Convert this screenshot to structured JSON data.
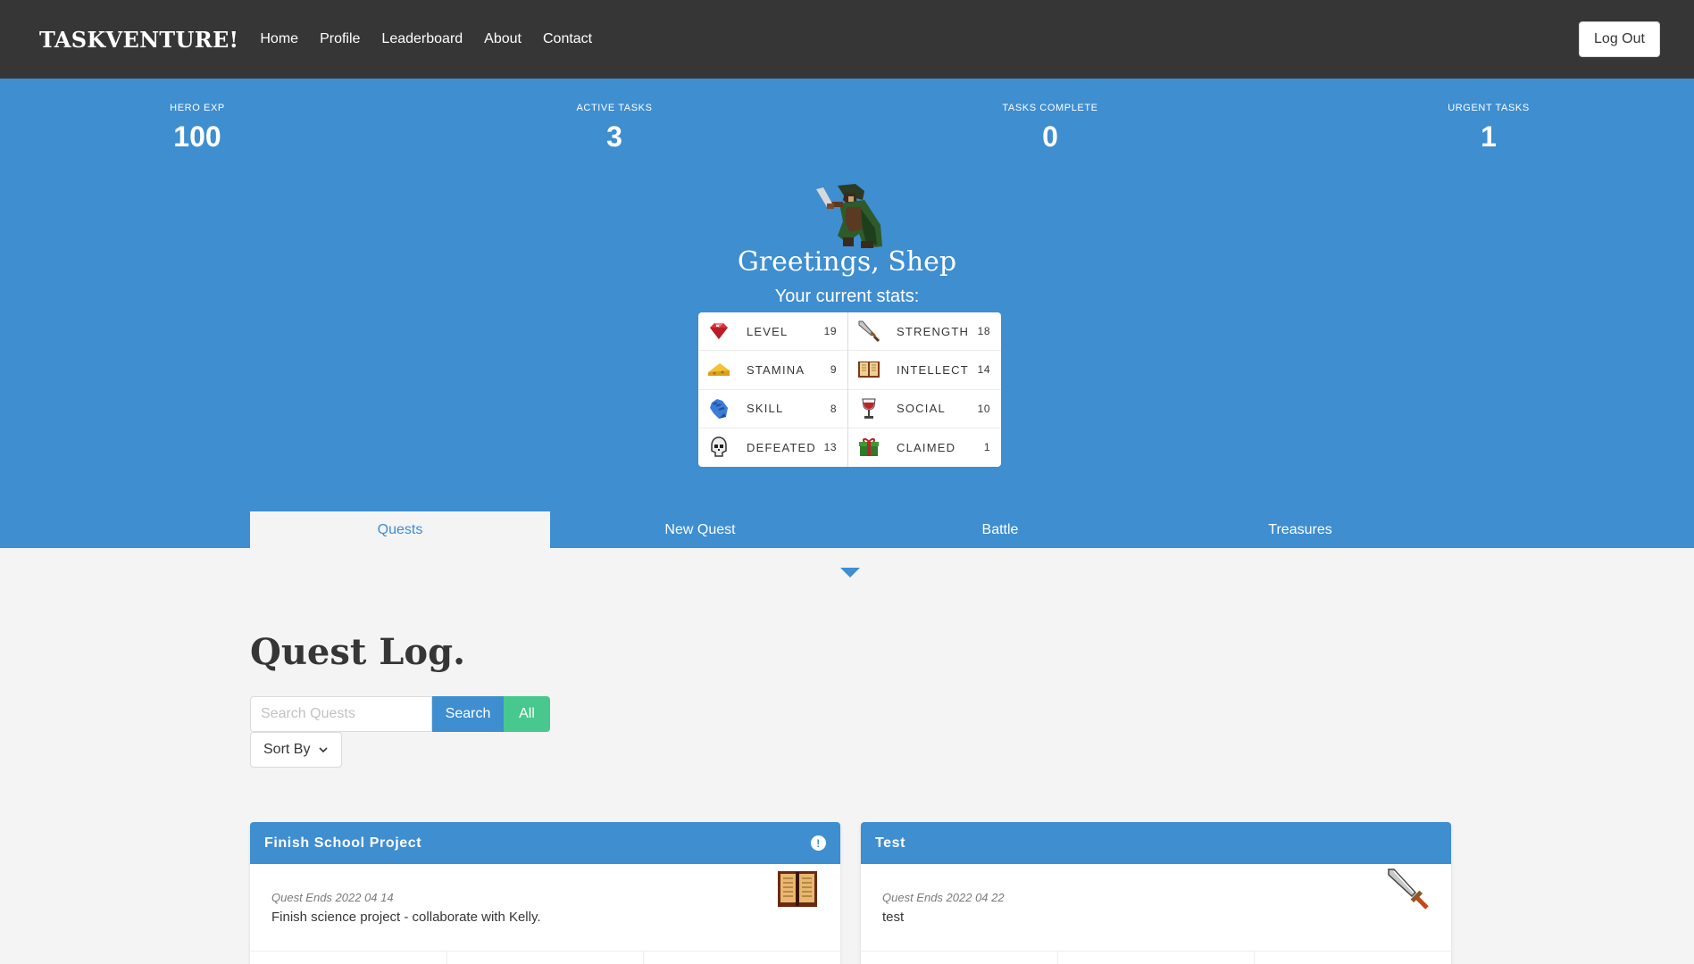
{
  "navbar": {
    "brand": "TASKVENTURE!",
    "links": [
      "Home",
      "Profile",
      "Leaderboard",
      "About",
      "Contact"
    ],
    "logout_label": "Log Out"
  },
  "hero_stats": [
    {
      "heading": "HERO EXP",
      "value": "100"
    },
    {
      "heading": "ACTIVE TASKS",
      "value": "3"
    },
    {
      "heading": "TASKS COMPLETE",
      "value": "0"
    },
    {
      "heading": "URGENT TASKS",
      "value": "1"
    }
  ],
  "greeting": "Greetings, Shep",
  "subgreeting": "Your current stats:",
  "stats_left": [
    {
      "label": "LEVEL",
      "value": "19",
      "icon": "gem-icon"
    },
    {
      "label": "STAMINA",
      "value": "9",
      "icon": "cheese-icon"
    },
    {
      "label": "SKILL",
      "value": "8",
      "icon": "glove-icon"
    },
    {
      "label": "DEFEATED",
      "value": "13",
      "icon": "skull-icon"
    }
  ],
  "stats_right": [
    {
      "label": "STRENGTH",
      "value": "18",
      "icon": "sword-icon"
    },
    {
      "label": "INTELLECT",
      "value": "14",
      "icon": "book-icon"
    },
    {
      "label": "SOCIAL",
      "value": "10",
      "icon": "goblet-icon"
    },
    {
      "label": "CLAIMED",
      "value": "1",
      "icon": "gift-icon"
    }
  ],
  "tabs": [
    "Quests",
    "New Quest",
    "Battle",
    "Treasures"
  ],
  "quest_log": {
    "title": "Quest Log.",
    "search_placeholder": "Search Quests",
    "search_label": "Search",
    "all_label": "All",
    "sort_label": "Sort By"
  },
  "cards": [
    {
      "title": "Finish School Project",
      "urgent_mark": "!",
      "ends": "Quest Ends 2022 04 14",
      "desc": "Finish science project - collaborate with Kelly.",
      "icon": "book-icon"
    },
    {
      "title": "Test",
      "ends": "Quest Ends 2022 04 22",
      "desc": "test",
      "icon": "sword-icon"
    }
  ],
  "colors": {
    "primary": "#3e8ed0",
    "success": "#48c78e",
    "dark": "#363636",
    "background": "#f4f4f4"
  }
}
